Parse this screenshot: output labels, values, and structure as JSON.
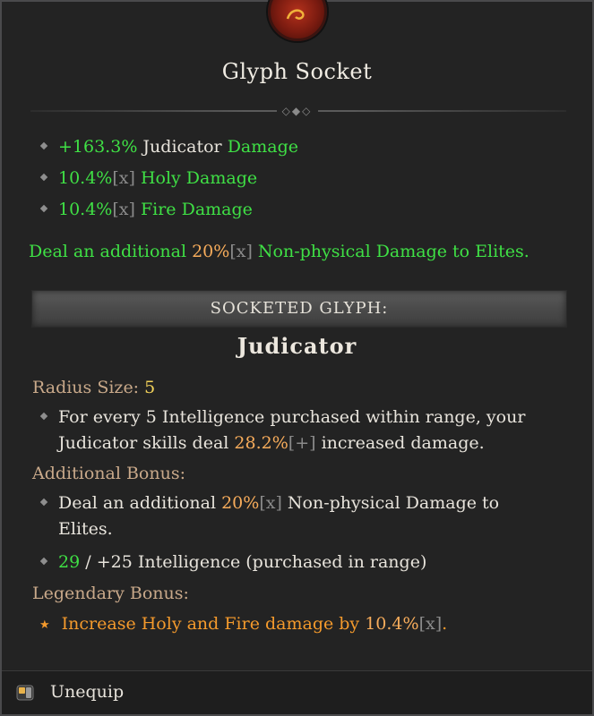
{
  "title": "Glyph Socket",
  "stats": [
    {
      "prefix": "+163.3%",
      "middle": "Judicator",
      "suffix": "Damage"
    },
    {
      "prefix": "10.4%",
      "tag": "[x]",
      "suffix": "Holy Damage"
    },
    {
      "prefix": "10.4%",
      "tag": "[x]",
      "suffix": "Fire Damage"
    }
  ],
  "elite_line": {
    "pre": "Deal an additional",
    "value": "20%",
    "tag": "[x]",
    "post": "Non-physical Damage to Elites."
  },
  "socketed_label": "SOCKETED GLYPH:",
  "glyph": {
    "name": "Judicator",
    "radius_label": "Radius Size:",
    "radius_value": "5",
    "desc_line1": "For every 5 Intelligence purchased within range, your",
    "desc_skill": "Judicator",
    "desc_mid": "skills deal",
    "desc_value": "28.2%",
    "desc_tag": "[+]",
    "desc_end": "increased damage.",
    "additional_label": "Additional Bonus:",
    "add_pre": "Deal an additional",
    "add_value": "20%",
    "add_tag": "[x]",
    "add_post": "Non-physical Damage to",
    "add_post2": "Elites.",
    "int_current": "29",
    "int_sep": "/",
    "int_req": "+25 Intelligence (purchased in range)",
    "legendary_label": "Legendary Bonus:",
    "leg_text": "Increase Holy and Fire damage by",
    "leg_value": "10.4%",
    "leg_tag": "[x]",
    "leg_end": "."
  },
  "footer": {
    "unequip_label": "Unequip",
    "icon": "mouse-icon"
  },
  "colors": {
    "bonus_green": "#3fe045",
    "value_orange": "#f7ac5b",
    "legendary_orange": "#f49a2c",
    "radius_gold": "#f2d25a"
  }
}
